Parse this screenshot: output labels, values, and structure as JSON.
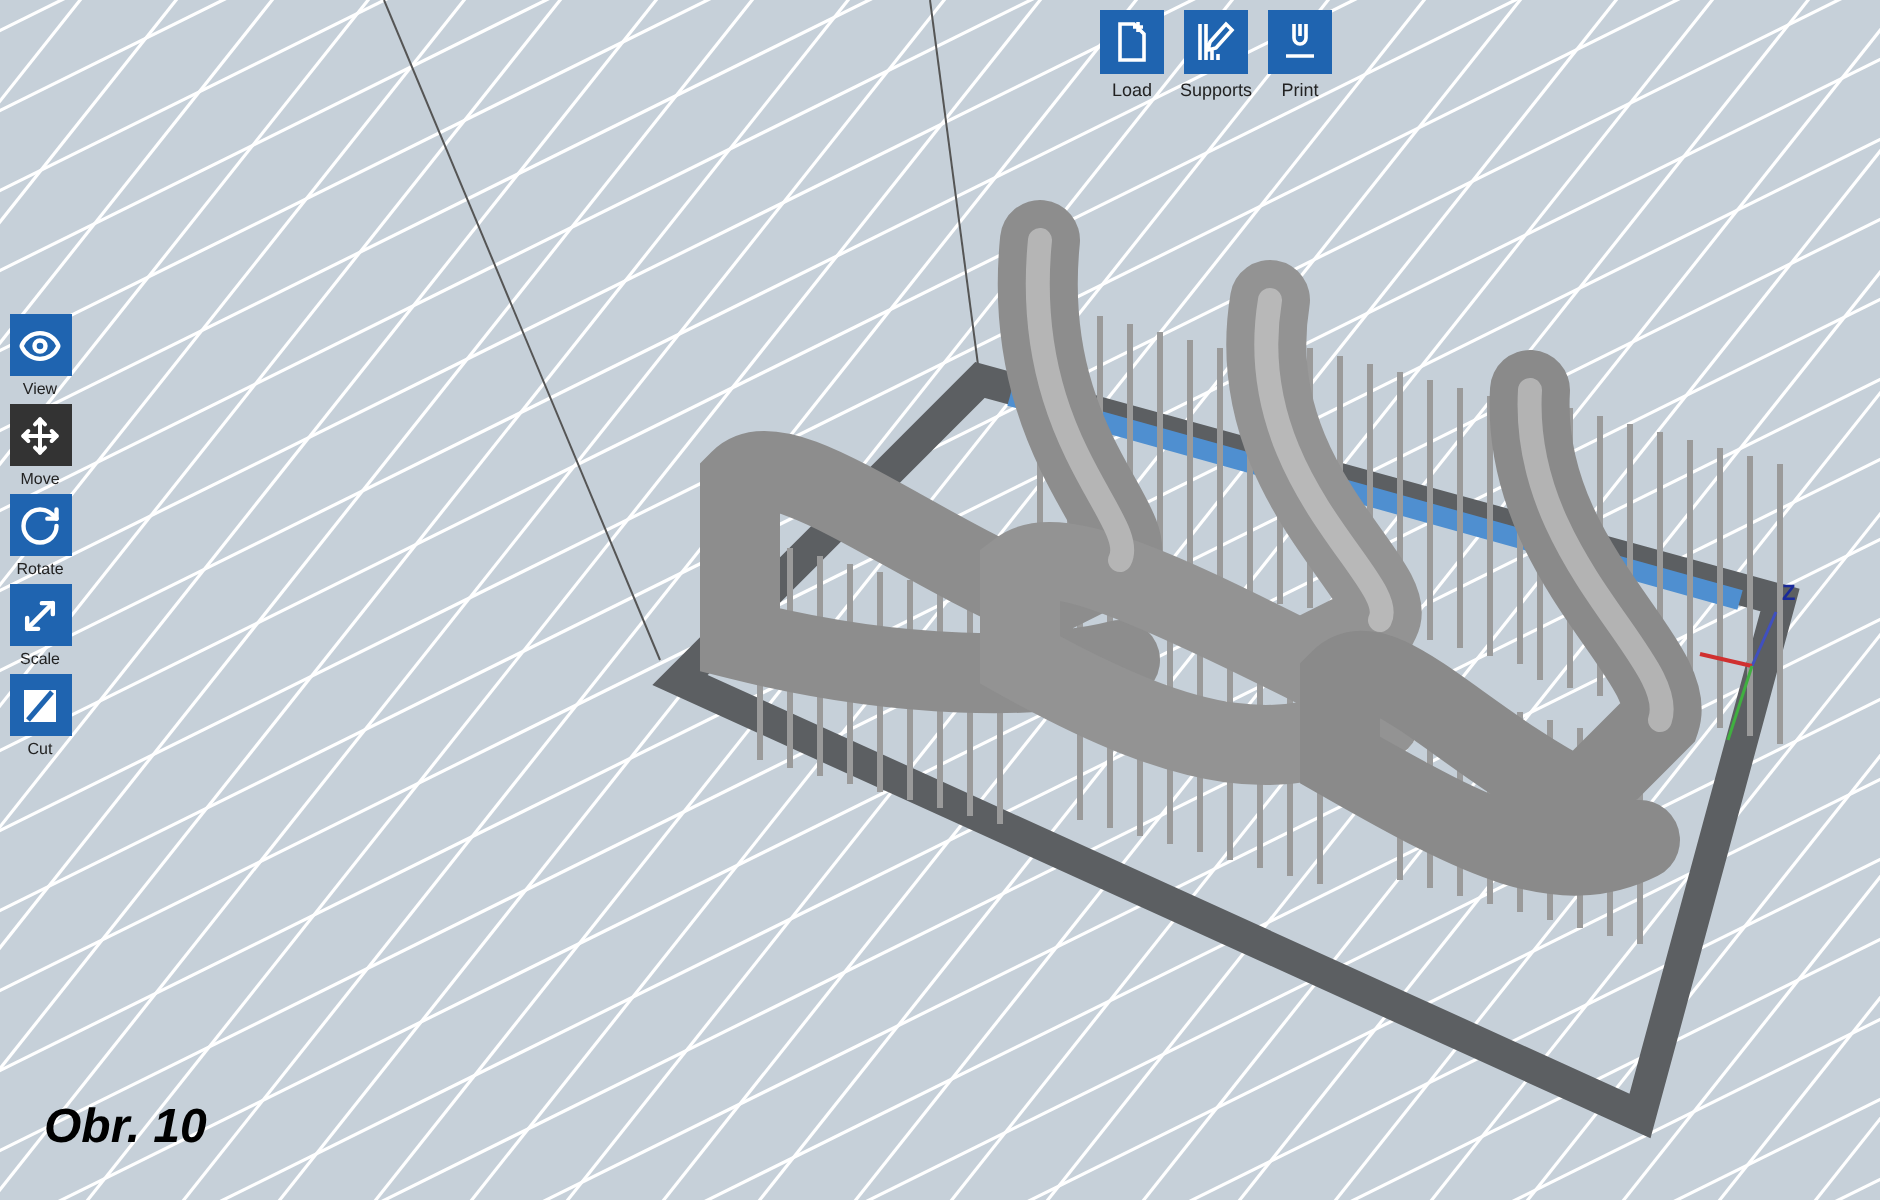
{
  "top_toolbar": {
    "buttons": [
      {
        "kind": "load",
        "label": "Load"
      },
      {
        "kind": "supports",
        "label": "Supports"
      },
      {
        "kind": "print",
        "label": "Print"
      }
    ]
  },
  "left_toolbar": {
    "tools": [
      {
        "kind": "view",
        "label": "View",
        "selected": false
      },
      {
        "kind": "move",
        "label": "Move",
        "selected": true
      },
      {
        "kind": "rotate",
        "label": "Rotate",
        "selected": false
      },
      {
        "kind": "scale",
        "label": "Scale",
        "selected": false
      },
      {
        "kind": "cut",
        "label": "Cut",
        "selected": false
      }
    ]
  },
  "axis_gizmo": {
    "label": "Z"
  },
  "caption": "Obr. 10"
}
